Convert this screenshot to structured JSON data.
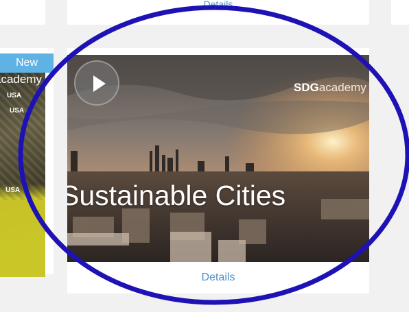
{
  "top_card": {
    "details_label": "Details"
  },
  "left_card": {
    "badge": "New",
    "wordmark": "academy",
    "tags": [
      "USA",
      "USA",
      "USA"
    ]
  },
  "center_card": {
    "brand_bold": "SDG",
    "brand_light": "academy",
    "title": "Sustainable Cities",
    "details_label": "Details"
  },
  "colors": {
    "link": "#4a90c8",
    "badge": "#5fb2e4",
    "annotation": "#1e12b4"
  },
  "icons": {
    "play": "play-icon"
  }
}
